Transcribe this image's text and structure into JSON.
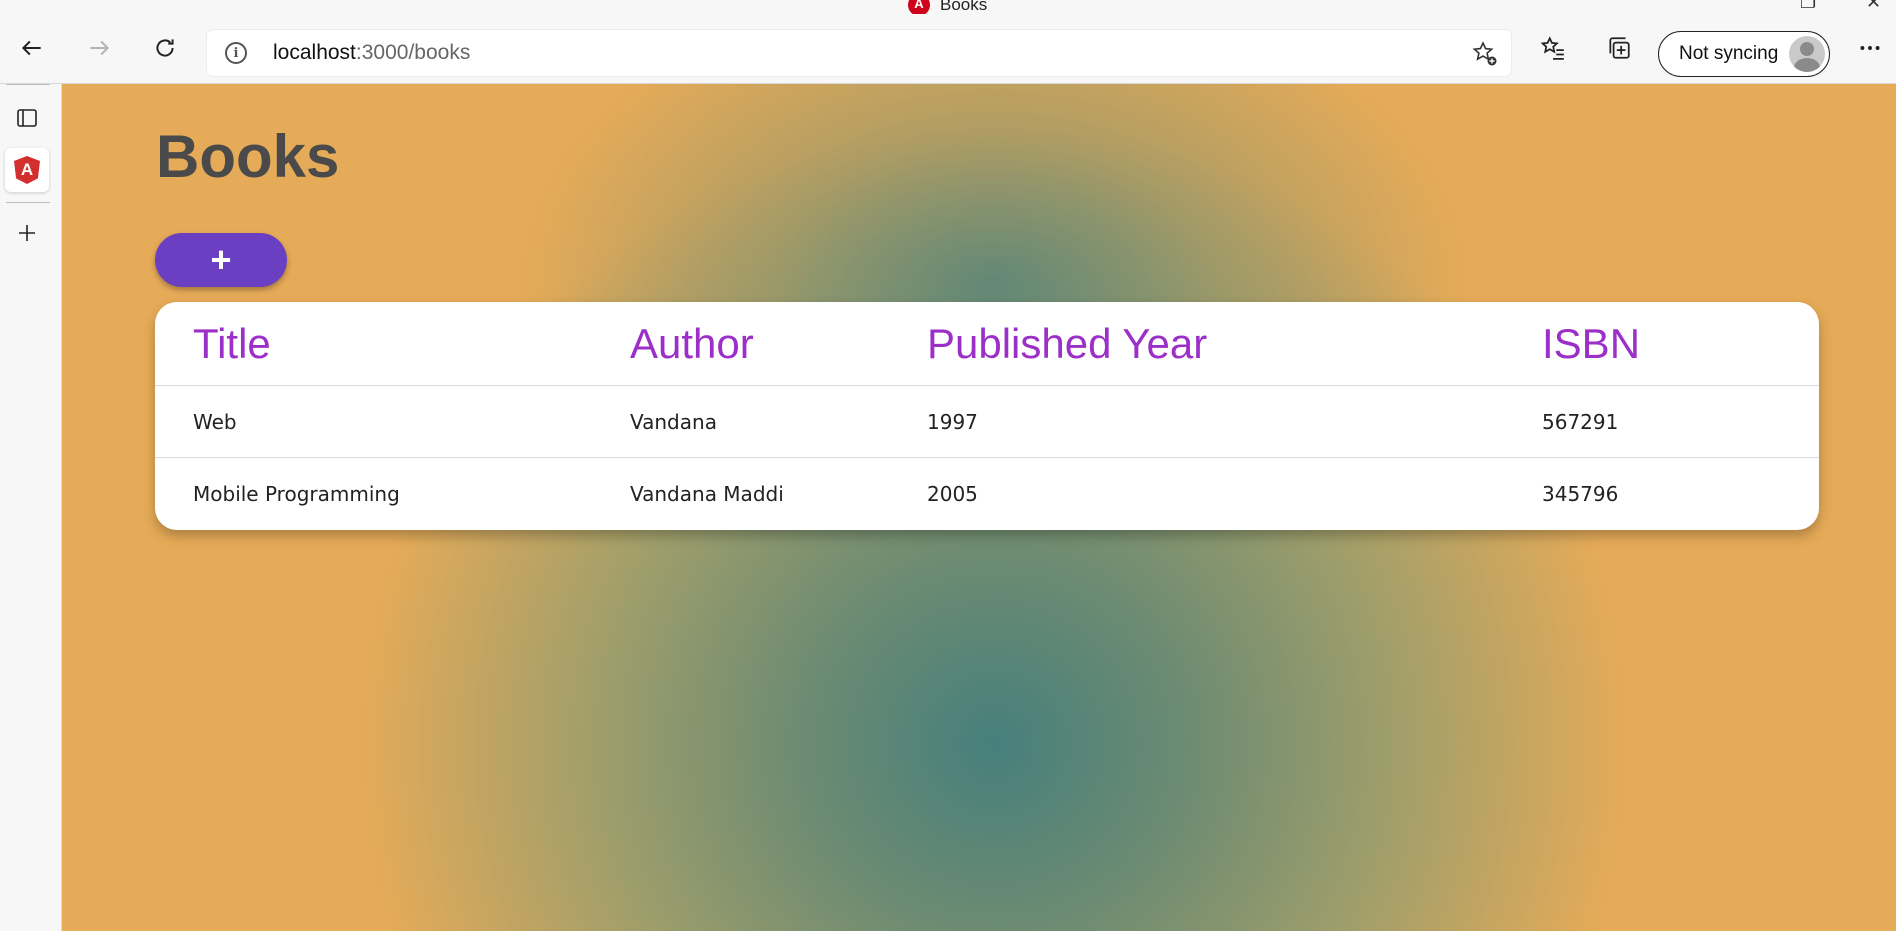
{
  "browser": {
    "tab_title": "Books",
    "url_host": "localhost",
    "url_path": ":3000/books",
    "sync_label": "Not syncing"
  },
  "page": {
    "title": "Books",
    "add_button_label": "+"
  },
  "table": {
    "headers": [
      "Title",
      "Author",
      "Published Year",
      "ISBN"
    ],
    "rows": [
      [
        "Web",
        "Vandana",
        "1997",
        "567291"
      ],
      [
        "Mobile Programming",
        "Vandana Maddi",
        "2005",
        "345796"
      ]
    ]
  },
  "colors": {
    "header_text": "#9b2fc7",
    "add_button": "#6a3fc1",
    "page_title": "#4a4a4a",
    "gradient_center": "#467f7c",
    "gradient_edge": "#e6ab58"
  },
  "icons": {
    "tab_favicon": "angular-icon"
  }
}
